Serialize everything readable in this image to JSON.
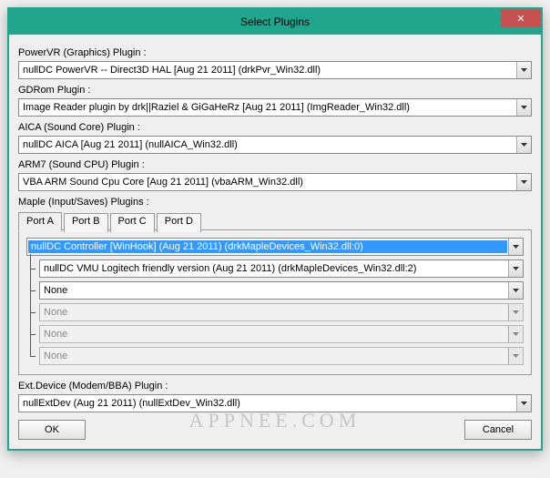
{
  "window": {
    "title": "Select Plugins"
  },
  "sections": {
    "powervr": {
      "label": "PowerVR (Graphics) Plugin :",
      "value": "nullDC PowerVR -- Direct3D HAL [Aug 21 2011] (drkPvr_Win32.dll)"
    },
    "gdrom": {
      "label": "GDRom Plugin :",
      "value": "Image Reader plugin by drk||Raziel & GiGaHeRz [Aug 21 2011] (ImgReader_Win32.dll)"
    },
    "aica": {
      "label": "AICA (Sound Core) Plugin :",
      "value": "nullDC AICA [Aug 21 2011] (nullAICA_Win32.dll)"
    },
    "arm7": {
      "label": "ARM7 (Sound CPU) Plugin :",
      "value": "VBA ARM Sound Cpu Core [Aug 21 2011] (vbaARM_Win32.dll)"
    },
    "maple": {
      "label": "Maple (Input/Saves) Plugins :"
    },
    "extdev": {
      "label": "Ext.Device (Modem/BBA) Plugin :",
      "value": "nullExtDev (Aug 21 2011) (nullExtDev_Win32.dll)"
    }
  },
  "maple": {
    "tabs": [
      "Port A",
      "Port B",
      "Port C",
      "Port D"
    ],
    "active_tab": "Port A",
    "rows": [
      {
        "value": "nullDC Controller [WinHook] (Aug 21 2011) (drkMapleDevices_Win32.dll:0)",
        "highlighted": true,
        "enabled": true,
        "indent": 0
      },
      {
        "value": "nullDC VMU Logitech friendly version (Aug 21 2011) (drkMapleDevices_Win32.dll:2)",
        "enabled": true,
        "indent": 1
      },
      {
        "value": "None",
        "enabled": true,
        "indent": 1
      },
      {
        "value": "None",
        "enabled": false,
        "indent": 1
      },
      {
        "value": "None",
        "enabled": false,
        "indent": 1
      },
      {
        "value": "None",
        "enabled": false,
        "indent": 1
      }
    ]
  },
  "buttons": {
    "ok": "OK",
    "cancel": "Cancel"
  },
  "watermark": "APPNEE.COM"
}
